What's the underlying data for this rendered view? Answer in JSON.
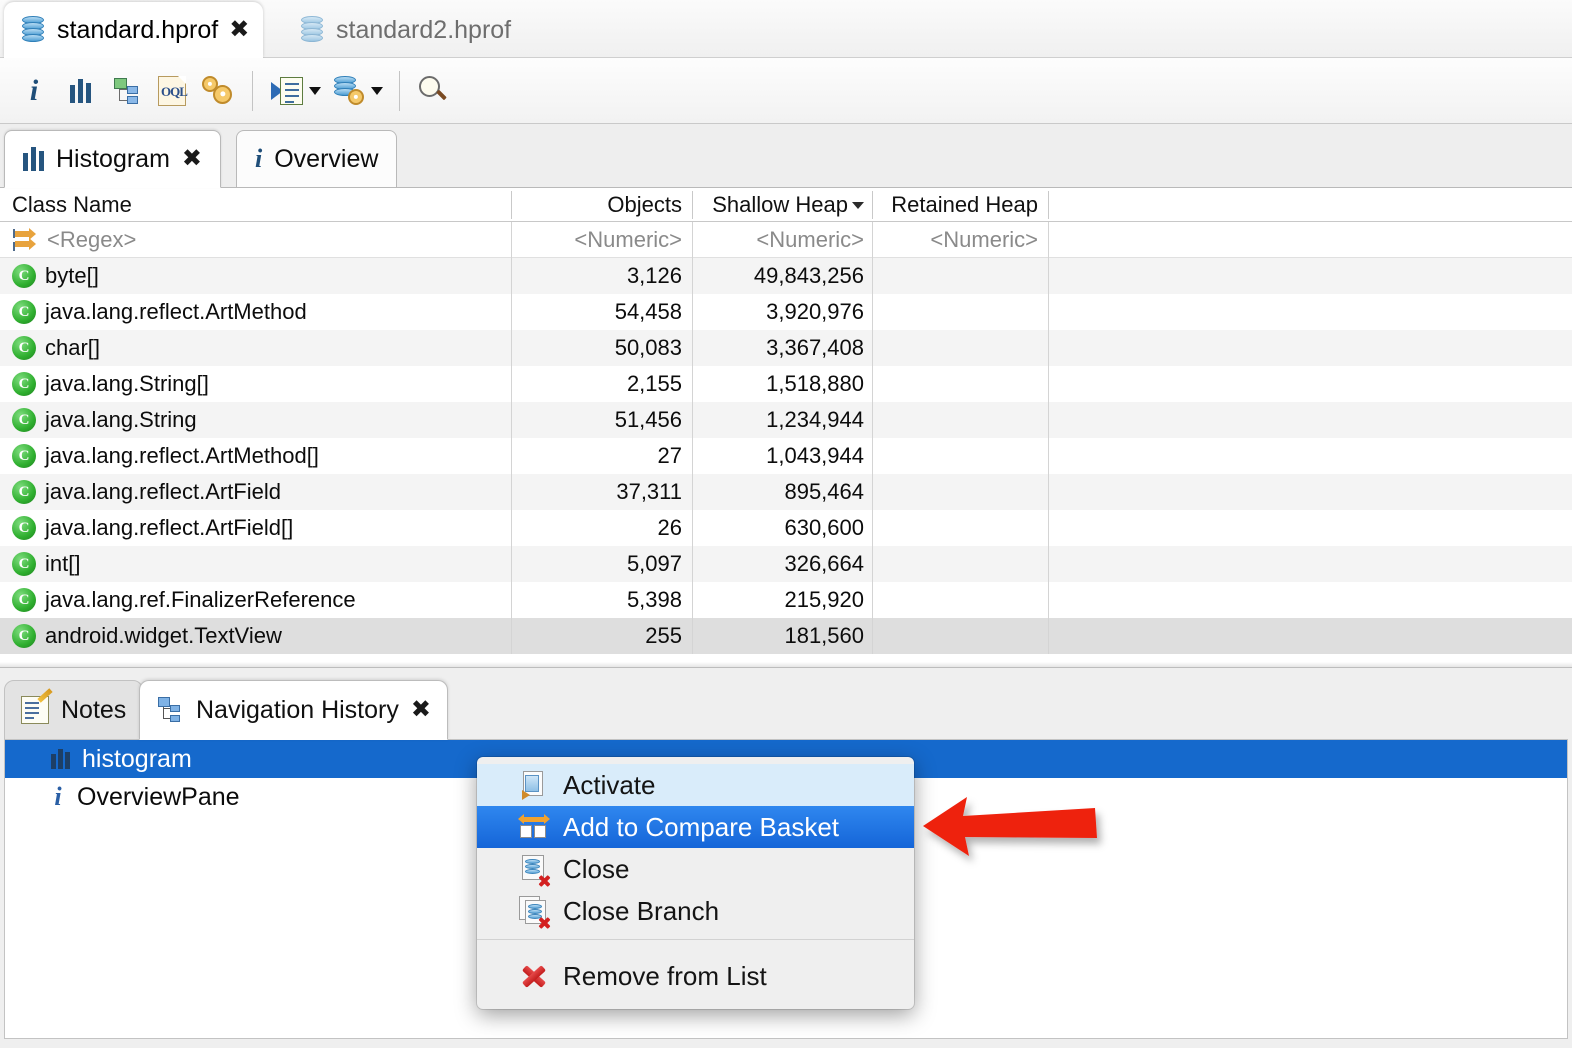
{
  "editor_tabs": [
    {
      "label": "standard.hprof",
      "icon": "heap-dump-icon",
      "active": true,
      "close": "✖"
    },
    {
      "label": "standard2.hprof",
      "icon": "heap-dump-icon",
      "active": false
    }
  ],
  "toolbar": {
    "buttons": [
      {
        "name": "overview-info-button",
        "icon": "info-icon"
      },
      {
        "name": "histogram-button",
        "icon": "histogram-icon"
      },
      {
        "name": "dominator-tree-button",
        "icon": "dominator-tree-icon"
      },
      {
        "name": "oql-button",
        "icon": "oql-document-icon"
      },
      {
        "name": "calculate-retained-size-button",
        "icon": "gears-icon"
      },
      {
        "name": "run-expert-system-button",
        "icon": "run-report-icon",
        "has_dropdown": true
      },
      {
        "name": "heap-dump-actions-button",
        "icon": "heap-settings-icon",
        "has_dropdown": true
      },
      {
        "name": "find-button",
        "icon": "search-icon"
      }
    ]
  },
  "view_tabs": [
    {
      "label": "Histogram",
      "icon": "histogram-icon",
      "active": true,
      "close": "✖"
    },
    {
      "label": "Overview",
      "icon": "info-icon",
      "active": false
    }
  ],
  "table": {
    "columns": [
      "Class Name",
      "Objects",
      "Shallow Heap",
      "Retained Heap",
      ""
    ],
    "sorted_column": "Shallow Heap",
    "sort_direction": "descending",
    "filter_row": {
      "class_name": "<Regex>",
      "objects": "<Numeric>",
      "shallow_heap": "<Numeric>",
      "retained_heap": "<Numeric>"
    },
    "rows": [
      {
        "class_name": "byte[]",
        "objects": "3,126",
        "shallow_heap": "49,843,256",
        "retained_heap": "",
        "selected": false
      },
      {
        "class_name": "java.lang.reflect.ArtMethod",
        "objects": "54,458",
        "shallow_heap": "3,920,976",
        "retained_heap": "",
        "selected": false
      },
      {
        "class_name": "char[]",
        "objects": "50,083",
        "shallow_heap": "3,367,408",
        "retained_heap": "",
        "selected": false
      },
      {
        "class_name": "java.lang.String[]",
        "objects": "2,155",
        "shallow_heap": "1,518,880",
        "retained_heap": "",
        "selected": false
      },
      {
        "class_name": "java.lang.String",
        "objects": "51,456",
        "shallow_heap": "1,234,944",
        "retained_heap": "",
        "selected": false
      },
      {
        "class_name": "java.lang.reflect.ArtMethod[]",
        "objects": "27",
        "shallow_heap": "1,043,944",
        "retained_heap": "",
        "selected": false
      },
      {
        "class_name": "java.lang.reflect.ArtField",
        "objects": "37,311",
        "shallow_heap": "895,464",
        "retained_heap": "",
        "selected": false
      },
      {
        "class_name": "java.lang.reflect.ArtField[]",
        "objects": "26",
        "shallow_heap": "630,600",
        "retained_heap": "",
        "selected": false
      },
      {
        "class_name": "int[]",
        "objects": "5,097",
        "shallow_heap": "326,664",
        "retained_heap": "",
        "selected": false
      },
      {
        "class_name": "java.lang.ref.FinalizerReference",
        "objects": "5,398",
        "shallow_heap": "215,920",
        "retained_heap": "",
        "selected": false
      },
      {
        "class_name": "android.widget.TextView",
        "objects": "255",
        "shallow_heap": "181,560",
        "retained_heap": "",
        "selected": true
      }
    ]
  },
  "bottom_panel": {
    "tabs": [
      {
        "label": "Notes",
        "icon": "notes-icon",
        "active": false
      },
      {
        "label": "Navigation History",
        "icon": "navigation-history-icon",
        "active": true,
        "close": "✖"
      }
    ],
    "items": [
      {
        "label": "histogram",
        "icon": "histogram-icon",
        "selected": true
      },
      {
        "label": "OverviewPane",
        "icon": "info-icon",
        "selected": false
      }
    ]
  },
  "context_menu": {
    "items": [
      {
        "label": "Activate",
        "icon": "activate-icon",
        "state": "hover"
      },
      {
        "label": "Add to Compare Basket",
        "icon": "compare-basket-icon",
        "state": "highlight"
      },
      {
        "label": "Close",
        "icon": "close-heap-icon",
        "state": "normal"
      },
      {
        "label": "Close Branch",
        "icon": "close-branch-icon",
        "state": "normal"
      },
      {
        "label": "Remove from List",
        "icon": "remove-from-list-icon",
        "state": "normal",
        "after_separator": true
      }
    ]
  },
  "annotation": {
    "type": "arrow",
    "color": "#ee2211",
    "points_to": "Add to Compare Basket"
  },
  "colors": {
    "selection_blue": "#1569cc",
    "menu_highlight": "#1f73e0",
    "row_selected_gray": "#dedede",
    "annotation_red": "#ee2211"
  }
}
